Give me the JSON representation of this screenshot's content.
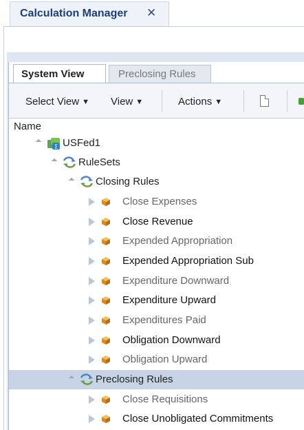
{
  "window": {
    "tab_title": "Calculation Manager",
    "close_glyph": "✕"
  },
  "tabs": [
    {
      "label": "System View",
      "active": true
    },
    {
      "label": "Preclosing Rules",
      "active": false
    }
  ],
  "toolbar": {
    "select_view": "Select View",
    "view": "View",
    "actions": "Actions"
  },
  "column_header": "Name",
  "tree": [
    {
      "label": "USFed1",
      "icon": "application-icon",
      "level": 0
    },
    {
      "label": "RuleSets",
      "icon": "ruleset-icon",
      "level": 1
    },
    {
      "label": "Closing Rules",
      "icon": "ruleset-icon",
      "level": 2
    },
    {
      "label": "Close Expenses",
      "icon": "rule-icon",
      "level": 3
    },
    {
      "label": "Close Revenue",
      "icon": "rule-icon",
      "level": 3
    },
    {
      "label": "Expended Appropriation",
      "icon": "rule-icon",
      "level": 3
    },
    {
      "label": "Expended Appropriation Sub",
      "icon": "rule-icon",
      "level": 3
    },
    {
      "label": "Expenditure Downward",
      "icon": "rule-icon",
      "level": 3
    },
    {
      "label": "Expenditure Upward",
      "icon": "rule-icon",
      "level": 3
    },
    {
      "label": "Expenditures Paid",
      "icon": "rule-icon",
      "level": 3
    },
    {
      "label": "Obligation Downward",
      "icon": "rule-icon",
      "level": 3
    },
    {
      "label": "Obligation Upward",
      "icon": "rule-icon",
      "level": 3
    },
    {
      "label": "Preclosing Rules",
      "icon": "ruleset-icon",
      "level": 2,
      "selected": true
    },
    {
      "label": "Close Requisitions",
      "icon": "rule-icon",
      "level": 3
    },
    {
      "label": "Close Unobligated Commitments",
      "icon": "rule-icon",
      "level": 3
    }
  ],
  "colors": {
    "selection": "#c6d4e6",
    "tab_title": "#1f3f7a",
    "panel_bg": "#dde6f1"
  }
}
